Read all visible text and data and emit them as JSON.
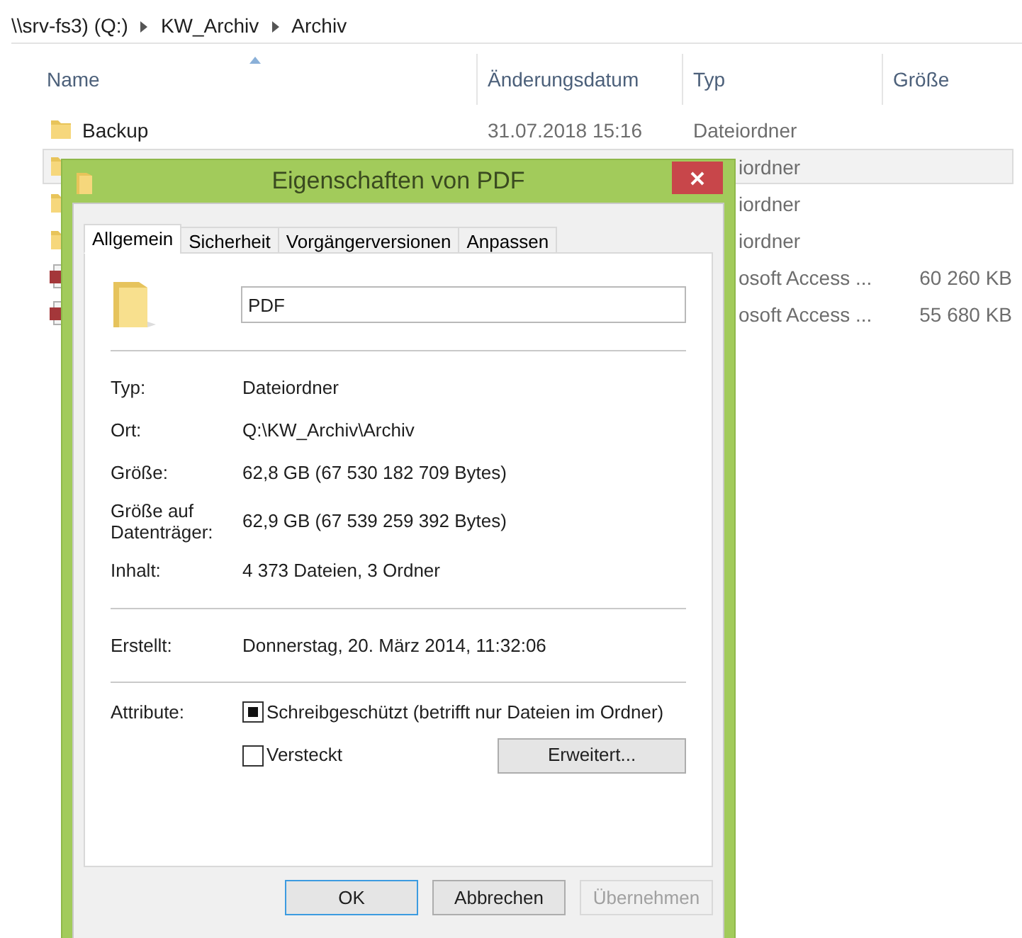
{
  "breadcrumb": [
    "\\\\srv-fs3) (Q:)",
    "KW_Archiv",
    "Archiv"
  ],
  "columns": [
    "Name",
    "Änderungsdatum",
    "Typ",
    "Größe"
  ],
  "rows": [
    {
      "kind": "folder",
      "selected": false,
      "name": "Backup",
      "date": "31.07.2018 15:16",
      "type": "Dateiordner"
    },
    {
      "kind": "folder",
      "selected": true,
      "type": "iordner"
    },
    {
      "kind": "folder",
      "selected": false,
      "type": "iordner"
    },
    {
      "kind": "folder",
      "selected": false,
      "type": "iordner"
    },
    {
      "kind": "access",
      "selected": false,
      "type": "osoft Access ...",
      "size": "60 260 KB"
    },
    {
      "kind": "access",
      "selected": false,
      "type": "osoft Access ...",
      "size": "55 680 KB"
    }
  ],
  "dialog": {
    "title": "Eigenschaften von PDF",
    "tabs": [
      {
        "label": "Allgemein",
        "selected": true
      },
      {
        "label": "Sicherheit",
        "selected": false
      },
      {
        "label": "Vorgängerversionen",
        "selected": false
      },
      {
        "label": "Anpassen",
        "selected": false
      }
    ],
    "name_field": "PDF",
    "groups": [
      [
        {
          "label": "Typ:",
          "value": "Dateiordner"
        },
        {
          "label": "Ort:",
          "value": "Q:\\KW_Archiv\\Archiv"
        },
        {
          "label": "Größe:",
          "value": "62,8 GB (67 530 182 709 Bytes)"
        },
        {
          "label": "Größe auf Datenträger:",
          "value": "62,9 GB (67 539 259 392 Bytes)"
        },
        {
          "label": "Inhalt:",
          "value": "4 373 Dateien, 3 Ordner"
        }
      ],
      [
        {
          "label": "Erstellt:",
          "value": "Donnerstag, 20. März 2014, 11:32:06"
        }
      ]
    ],
    "attributes_label": "Attribute:",
    "attributes": [
      {
        "label": "Schreibgeschützt (betrifft nur Dateien im Ordner)",
        "checked": false,
        "indeterminate": true
      },
      {
        "label": "Versteckt",
        "checked": false,
        "indeterminate": false
      }
    ],
    "advanced_button": "Erweitert...",
    "buttons": [
      {
        "label": "OK",
        "kind": "default",
        "disabled": false
      },
      {
        "label": "Abbrechen",
        "kind": "normal",
        "disabled": false
      },
      {
        "label": "Übernehmen",
        "kind": "normal",
        "disabled": true
      }
    ]
  }
}
